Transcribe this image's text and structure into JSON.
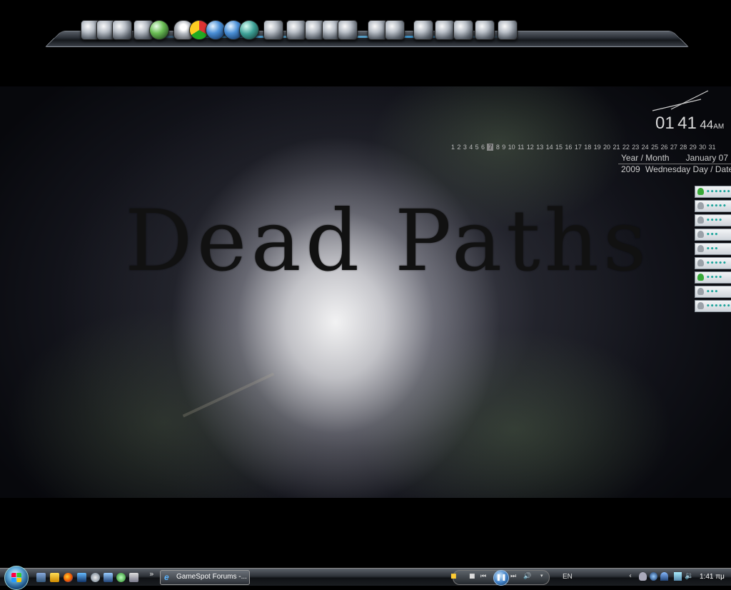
{
  "wallpaper": {
    "title": "Dead Paths"
  },
  "clock": {
    "hours": "01",
    "minutes": "41",
    "seconds": "44",
    "ampm": "AM"
  },
  "calendar": {
    "days": [
      "1",
      "2",
      "3",
      "4",
      "5",
      "6",
      "7",
      "8",
      "9",
      "10",
      "11",
      "12",
      "13",
      "14",
      "15",
      "16",
      "17",
      "18",
      "19",
      "20",
      "21",
      "22",
      "23",
      "24",
      "25",
      "26",
      "27",
      "28",
      "29",
      "30",
      "31"
    ],
    "today": "7",
    "year_month_label": "Year / Month",
    "month_day": "January 07",
    "year": "2009",
    "weekday_label": "Wednesday Day / Date"
  },
  "dock": {
    "icons": [
      "computer-icon",
      "phone-icon",
      "rss-icon",
      "settings-gear-icon",
      "globe-icon",
      "contacts-icon",
      "chrome-icon",
      "nero-icon",
      "joystick-icon",
      "notes-icon",
      "mail-icon",
      "mail-icon",
      "mail-icon",
      "mail-icon",
      "media-icon",
      "media-icon",
      "gear-icon",
      "network-icon",
      "tools-icon",
      "camera-icon",
      "film-reel-icon",
      "windows-icon"
    ]
  },
  "contacts": {
    "items": [
      {
        "status": "online",
        "name": "••••••"
      },
      {
        "status": "offline",
        "name": "•••••"
      },
      {
        "status": "offline",
        "name": "••••"
      },
      {
        "status": "offline",
        "name": "•••"
      },
      {
        "status": "offline",
        "name": "•••"
      },
      {
        "status": "offline",
        "name": "•••••"
      },
      {
        "status": "online",
        "name": "••••"
      },
      {
        "status": "offline",
        "name": "•••"
      },
      {
        "status": "offline",
        "name": "••••••"
      }
    ]
  },
  "taskbar": {
    "quicklaunch_chevron": "»",
    "task_gamespot_label": "GameSpot Forums -...",
    "language": "EN",
    "time": "1:41 πμ",
    "tray_chevron": "‹"
  },
  "colors": {
    "accent_blue": "#3fb4ff",
    "contact_text": "#1fa59c",
    "online_green": "#38a838"
  }
}
